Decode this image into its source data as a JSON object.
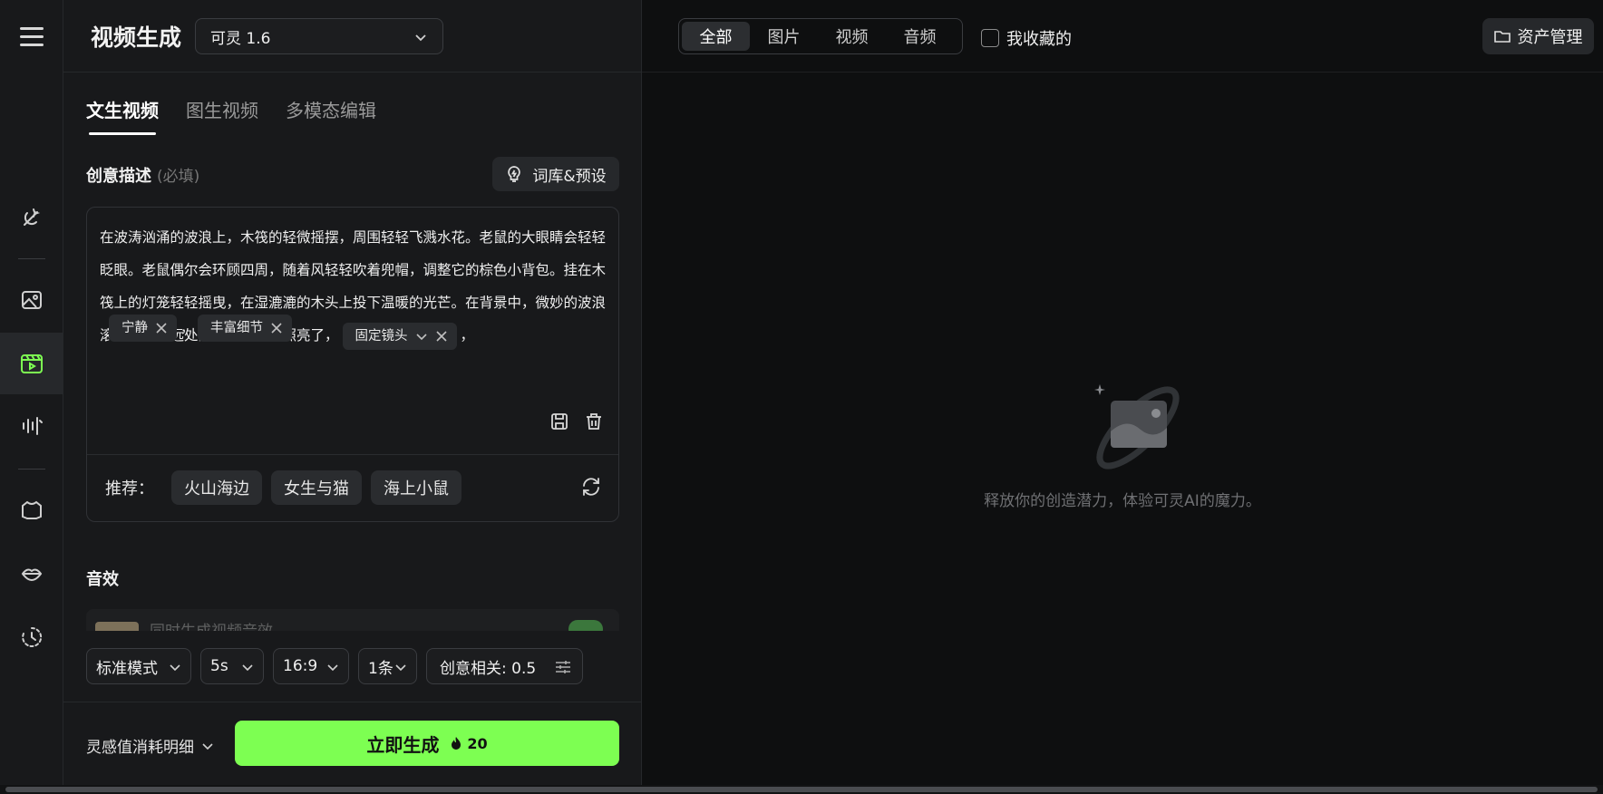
{
  "header": {
    "title": "视频生成",
    "model": "可灵 1.6"
  },
  "tabs": [
    {
      "label": "文生视频",
      "active": true
    },
    {
      "label": "图生视频",
      "active": false
    },
    {
      "label": "多模态编辑",
      "active": false
    }
  ],
  "prompt": {
    "label": "创意描述",
    "required_hint": "(必填)",
    "library_button": "词库&预设",
    "text": "在波涛汹涌的波浪上，木筏的轻微摇摆，周围轻轻飞溅水花。老鼠的大眼睛会轻轻眨眼。老鼠偶尔会环顾四周，随着风轻轻吹着兜帽，调整它的棕色小背包。挂在木筏上的灯笼轻轻摇曳，在湿漉漉的木头上投下温暖的光芒。在背景中，微妙的波浪滚滚而过，远处的闪电短暂地照亮了，",
    "chips": [
      "固定镜头",
      "宁静",
      "丰富细节"
    ],
    "separator": "，",
    "recommend_label": "推荐：",
    "recommendations": [
      "火山海边",
      "女生与猫",
      "海上小鼠"
    ]
  },
  "sound": {
    "title": "音效",
    "row_text": "同时生成视频音效"
  },
  "options": {
    "mode": "标准模式",
    "duration": "5s",
    "ratio": "16:9",
    "count": "1条",
    "creativity": "创意相关: 0.5"
  },
  "footer": {
    "cost_link": "灵感值消耗明细",
    "generate": "立即生成",
    "cost": "20"
  },
  "right": {
    "filters": [
      {
        "label": "全部",
        "active": true
      },
      {
        "label": "图片",
        "active": false
      },
      {
        "label": "视频",
        "active": false
      },
      {
        "label": "音频",
        "active": false
      }
    ],
    "favorites": "我收藏的",
    "asset_button": "资产管理",
    "empty_text": "释放你的创造潜力，体验可灵AI的魔力。"
  },
  "colors": {
    "accent": "#7dff52",
    "rail_active_icon": "#7dff52"
  }
}
